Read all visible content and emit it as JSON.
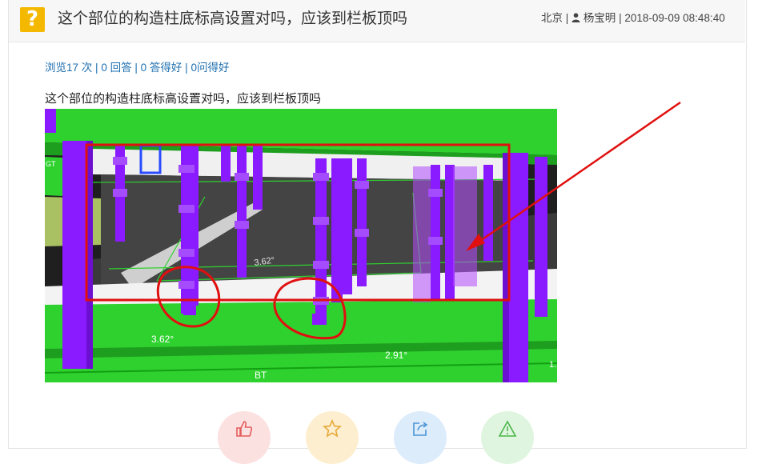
{
  "question": {
    "icon": "question-mark-icon",
    "title": "这个部位的构造柱底标高设置对吗，应该到栏板顶吗",
    "location": "北京",
    "user_icon": "user-icon",
    "author": "杨宝明",
    "timestamp": "2018-09-09 08:48:40"
  },
  "stats": {
    "views": "浏览17 次",
    "answers": "0 回答",
    "good_answers": "0 答得好",
    "good_questions": "0问得好",
    "separator": "|"
  },
  "body": {
    "text": "这个部位的构造柱底标高设置对吗，应该到栏板顶吗"
  },
  "screenshot": {
    "labels": {
      "level_left": "3.62°",
      "level_right": "2.91°",
      "slab": "3.62°",
      "bt": "BT",
      "gt": "GT",
      "side": "1."
    },
    "annotation_color": "#e01010",
    "slab_color": "#2fd12f",
    "column_color": "#8a1aff"
  },
  "actions": [
    {
      "name": "like-button",
      "icon": "thumbs-up-icon",
      "bg": "#fce1e1",
      "fg": "#e35d5d"
    },
    {
      "name": "favorite-button",
      "icon": "star-icon",
      "bg": "#fdeecf",
      "fg": "#e7a93a"
    },
    {
      "name": "share-button",
      "icon": "share-icon",
      "bg": "#dcecfb",
      "fg": "#4c95d6"
    },
    {
      "name": "report-button",
      "icon": "warning-icon",
      "bg": "#e0f5e0",
      "fg": "#49b649"
    }
  ]
}
